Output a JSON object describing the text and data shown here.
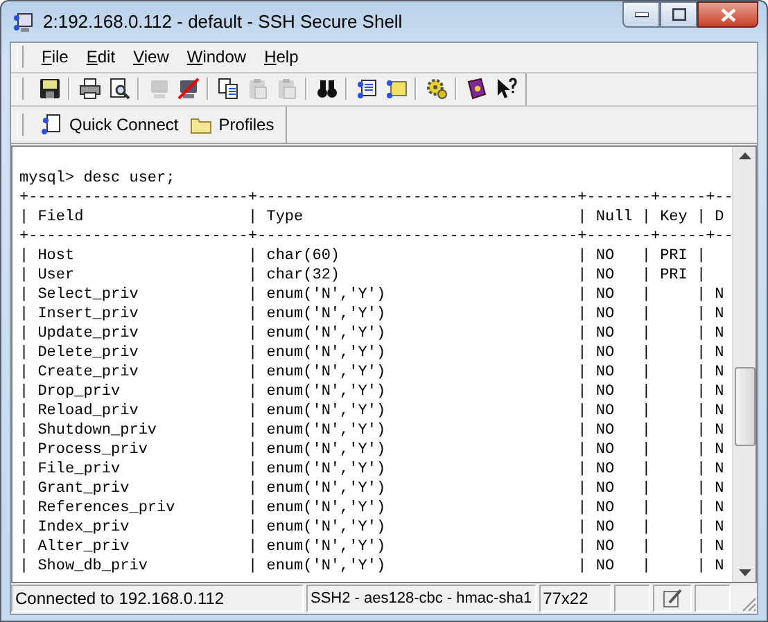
{
  "window": {
    "title": "2:192.168.0.112 - default - SSH Secure Shell"
  },
  "menu": [
    "File",
    "Edit",
    "View",
    "Window",
    "Help"
  ],
  "toolbar": [
    [
      {
        "kind": "save",
        "disabled": false
      }
    ],
    [
      {
        "kind": "print",
        "disabled": false
      },
      {
        "kind": "preview",
        "disabled": false
      }
    ],
    [
      {
        "kind": "terminal",
        "disabled": true
      },
      {
        "kind": "disconnect",
        "disabled": false
      }
    ],
    [
      {
        "kind": "copy",
        "disabled": false
      },
      {
        "kind": "paste",
        "disabled": true
      },
      {
        "kind": "paste-screen",
        "disabled": true
      }
    ],
    [
      {
        "kind": "find",
        "disabled": false
      }
    ],
    [
      {
        "kind": "connect",
        "disabled": false
      },
      {
        "kind": "transfer",
        "disabled": false
      }
    ],
    [
      {
        "kind": "settings",
        "disabled": false
      }
    ],
    [
      {
        "kind": "help",
        "disabled": false
      },
      {
        "kind": "context-help",
        "disabled": false
      }
    ]
  ],
  "quick_bar": [
    {
      "kind": "quick-connect",
      "label": "Quick Connect"
    },
    {
      "kind": "profiles",
      "label": "Profiles"
    }
  ],
  "terminal": {
    "lines": [
      "mysql> desc user;",
      "+------------------------+-----------------------------------+-------+-----+--",
      "| Field                  | Type                              | Null | Key | D",
      "+------------------------+-----------------------------------+-------+-----+--",
      "| Host                   | char(60)                          | NO   | PRI |",
      "| User                   | char(32)                          | NO   | PRI |",
      "| Select_priv            | enum('N','Y')                     | NO   |     | N",
      "| Insert_priv            | enum('N','Y')                     | NO   |     | N",
      "| Update_priv            | enum('N','Y')                     | NO   |     | N",
      "| Delete_priv            | enum('N','Y')                     | NO   |     | N",
      "| Create_priv            | enum('N','Y')                     | NO   |     | N",
      "| Drop_priv              | enum('N','Y')                     | NO   |     | N",
      "| Reload_priv            | enum('N','Y')                     | NO   |     | N",
      "| Shutdown_priv          | enum('N','Y')                     | NO   |     | N",
      "| Process_priv           | enum('N','Y')                     | NO   |     | N",
      "| File_priv              | enum('N','Y')                     | NO   |     | N",
      "| Grant_priv             | enum('N','Y')                     | NO   |     | N",
      "| References_priv        | enum('N','Y')                     | NO   |     | N",
      "| Index_priv             | enum('N','Y')                     | NO   |     | N",
      "| Alter_priv             | enum('N','Y')                     | NO   |     | N",
      "| Show_db_priv           | enum('N','Y')                     | NO   |     | N"
    ]
  },
  "status_bar": {
    "connection": "Connected to 192.168.0.112",
    "cipher": "SSH2 - aes128-cbc - hmac-sha1",
    "size": "77x22"
  }
}
